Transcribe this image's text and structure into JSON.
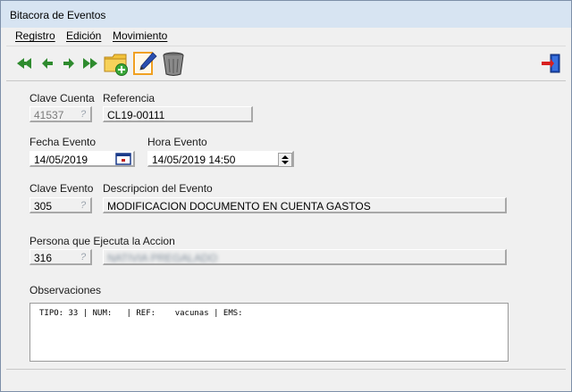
{
  "window": {
    "title": "Bitacora de Eventos"
  },
  "menu": [
    {
      "label": "Registro"
    },
    {
      "label": "Edición"
    },
    {
      "label": "Movimiento"
    }
  ],
  "toolbar": {
    "buttons": [
      "first-record-icon",
      "previous-record-icon",
      "next-record-icon",
      "last-record-icon",
      "new-folder-icon",
      "edit-document-icon",
      "trash-icon"
    ],
    "exit": "exit-door-icon"
  },
  "form": {
    "clave_cuenta": {
      "label": "Clave Cuenta",
      "value": "41537"
    },
    "referencia": {
      "label": "Referencia",
      "value": "CL19-00111"
    },
    "fecha_evento": {
      "label": "Fecha Evento",
      "value": "14/05/2019"
    },
    "hora_evento": {
      "label": "Hora Evento",
      "value": "14/05/2019 14:50"
    },
    "clave_evento": {
      "label": "Clave Evento",
      "value": "305"
    },
    "descripcion": {
      "label": "Descripcion del Evento",
      "value": "MODIFICACION DOCUMENTO EN CUENTA GASTOS"
    },
    "persona": {
      "label": "Persona que Ejecuta la Accion",
      "value": "316",
      "name": "NATIVIA PREGALADO"
    },
    "observaciones": {
      "label": "Observaciones",
      "value": "TIPO: 33 | NUM:   | REF:    vacunas | EMS:"
    }
  },
  "colors": {
    "titlebar": "#d7e4f2",
    "window": "#f0f0f0",
    "arrow": "#2e8b2e"
  }
}
